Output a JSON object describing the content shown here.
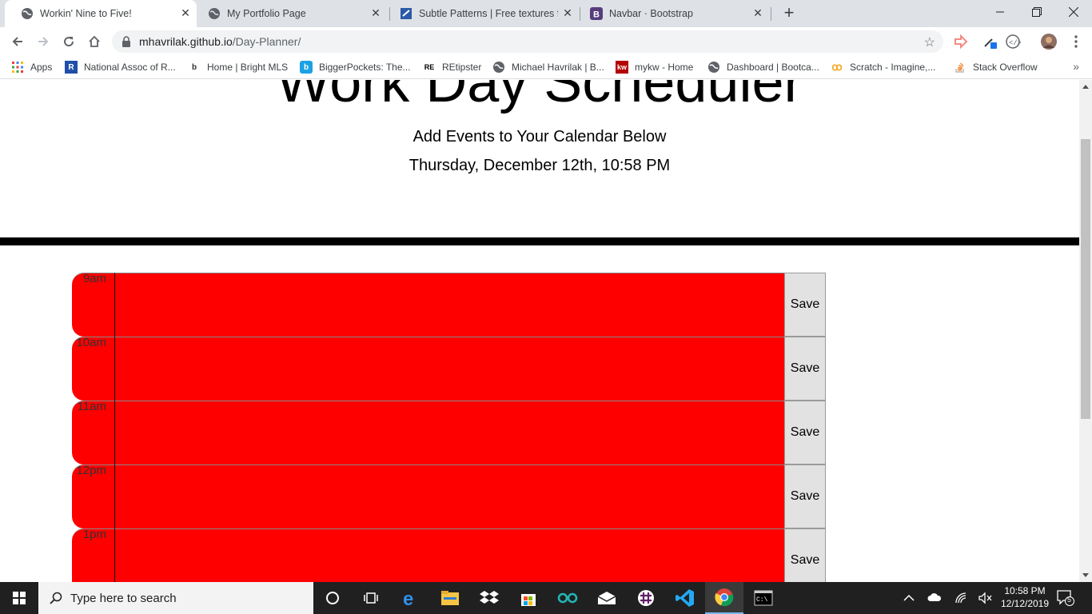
{
  "browser": {
    "tabs": [
      {
        "title": "Workin' Nine to Five!",
        "active": true
      },
      {
        "title": "My Portfolio Page",
        "active": false
      },
      {
        "title": "Subtle Patterns | Free textures for",
        "active": false
      },
      {
        "title": "Navbar · Bootstrap",
        "active": false
      }
    ],
    "url_host": "mhavrilak.github.io",
    "url_path": "/Day-Planner/",
    "bookmarks": [
      {
        "label": "Apps",
        "icon": "apps-grid-icon"
      },
      {
        "label": "National Assoc of R...",
        "icon": "realtor-icon"
      },
      {
        "label": "Home | Bright MLS",
        "icon": "bright-mls-icon"
      },
      {
        "label": "BiggerPockets: The...",
        "icon": "biggerpockets-icon"
      },
      {
        "label": "REtipster",
        "icon": "retipster-icon"
      },
      {
        "label": "Michael Havrilak | B...",
        "icon": "globe-icon"
      },
      {
        "label": "mykw - Home",
        "icon": "kw-icon"
      },
      {
        "label": "Dashboard | Bootca...",
        "icon": "globe-icon"
      },
      {
        "label": "Scratch - Imagine,...",
        "icon": "scratch-icon"
      },
      {
        "label": "Stack Overflow",
        "icon": "stackoverflow-icon"
      }
    ]
  },
  "page": {
    "title": "Work Day Scheduler",
    "lead": "Add Events to Your Calendar Below",
    "current_date": "Thursday, December 12th, 10:58 PM",
    "past_color": "#ff0000",
    "rows": [
      {
        "hour": "9am",
        "save_label": "Save"
      },
      {
        "hour": "10am",
        "save_label": "Save"
      },
      {
        "hour": "11am",
        "save_label": "Save"
      },
      {
        "hour": "12pm",
        "save_label": "Save"
      },
      {
        "hour": "1pm",
        "save_label": "Save"
      }
    ]
  },
  "taskbar": {
    "search_placeholder": "Type here to search",
    "time": "10:58 PM",
    "date": "12/12/2019",
    "notification_count": "5"
  }
}
